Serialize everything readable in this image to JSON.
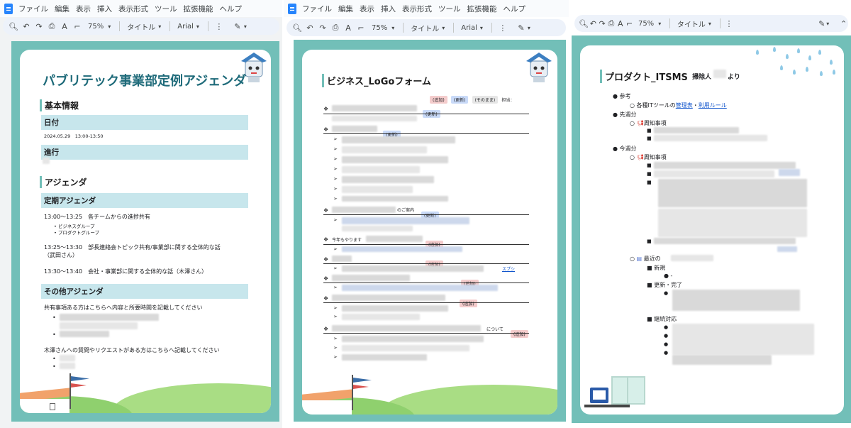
{
  "menu": [
    "ファイル",
    "編集",
    "表示",
    "挿入",
    "表示形式",
    "ツール",
    "拡張機能",
    "ヘルプ"
  ],
  "toolbar": {
    "zoom": "75%",
    "style": "タイトル",
    "font": "Arial"
  },
  "doc1": {
    "title": "パブリテック事業部定例アジェンダ",
    "basic_heading": "基本情報",
    "date_label": "日付",
    "date_value": "2024.05.29　13:00-13:50",
    "progress_label": "進行",
    "agenda_heading": "アジェンダ",
    "regular_heading": "定期アジェンダ",
    "item1": "13:00〜13:25　各チームからの進捗共有",
    "item1_sub": [
      "ビジネスグループ",
      "プロダクトグループ"
    ],
    "item2_line1": "13:25〜13:30　部長連絡会トピック共有/事業部に関する全体的な話",
    "item2_line2": "（武田さん）",
    "item3": "13:30〜13:40　会社・事業部に関する全体的な話（木澤さん）",
    "other_heading": "その他アジェンダ",
    "other_text1": "共有事項ある方はこちらへ内容と所要時間を記載してください",
    "other_text2": "木澤さんへの質問やリクエストがある方はこちらへ記載してください"
  },
  "doc2": {
    "title": "ビジネス_LoGoフォーム",
    "legend": [
      "(追加)",
      "(更新)",
      "(そのまま)",
      "担当："
    ],
    "tag_update": "(更新)",
    "tag_add": "(追加)",
    "row_guide": "のご案内",
    "row_this_month": "今年もやります",
    "row_about": "について",
    "link_text": "スプシ"
  },
  "doc3": {
    "title": "プロダクト_ITSMS",
    "cleaner": "掃除人",
    "from": "より",
    "ref": "参考",
    "ref_sub_prefix": "各種ITツールの",
    "ref_link1": "管理表",
    "ref_sep": "・",
    "ref_link2": "利用ルール",
    "last_week": "先週分",
    "notice": "周知事項",
    "this_week": "今週分",
    "recent": "最近の",
    "new": "新規",
    "dash": "-",
    "update_done": "更新・完了",
    "ongoing": "継続対応"
  }
}
